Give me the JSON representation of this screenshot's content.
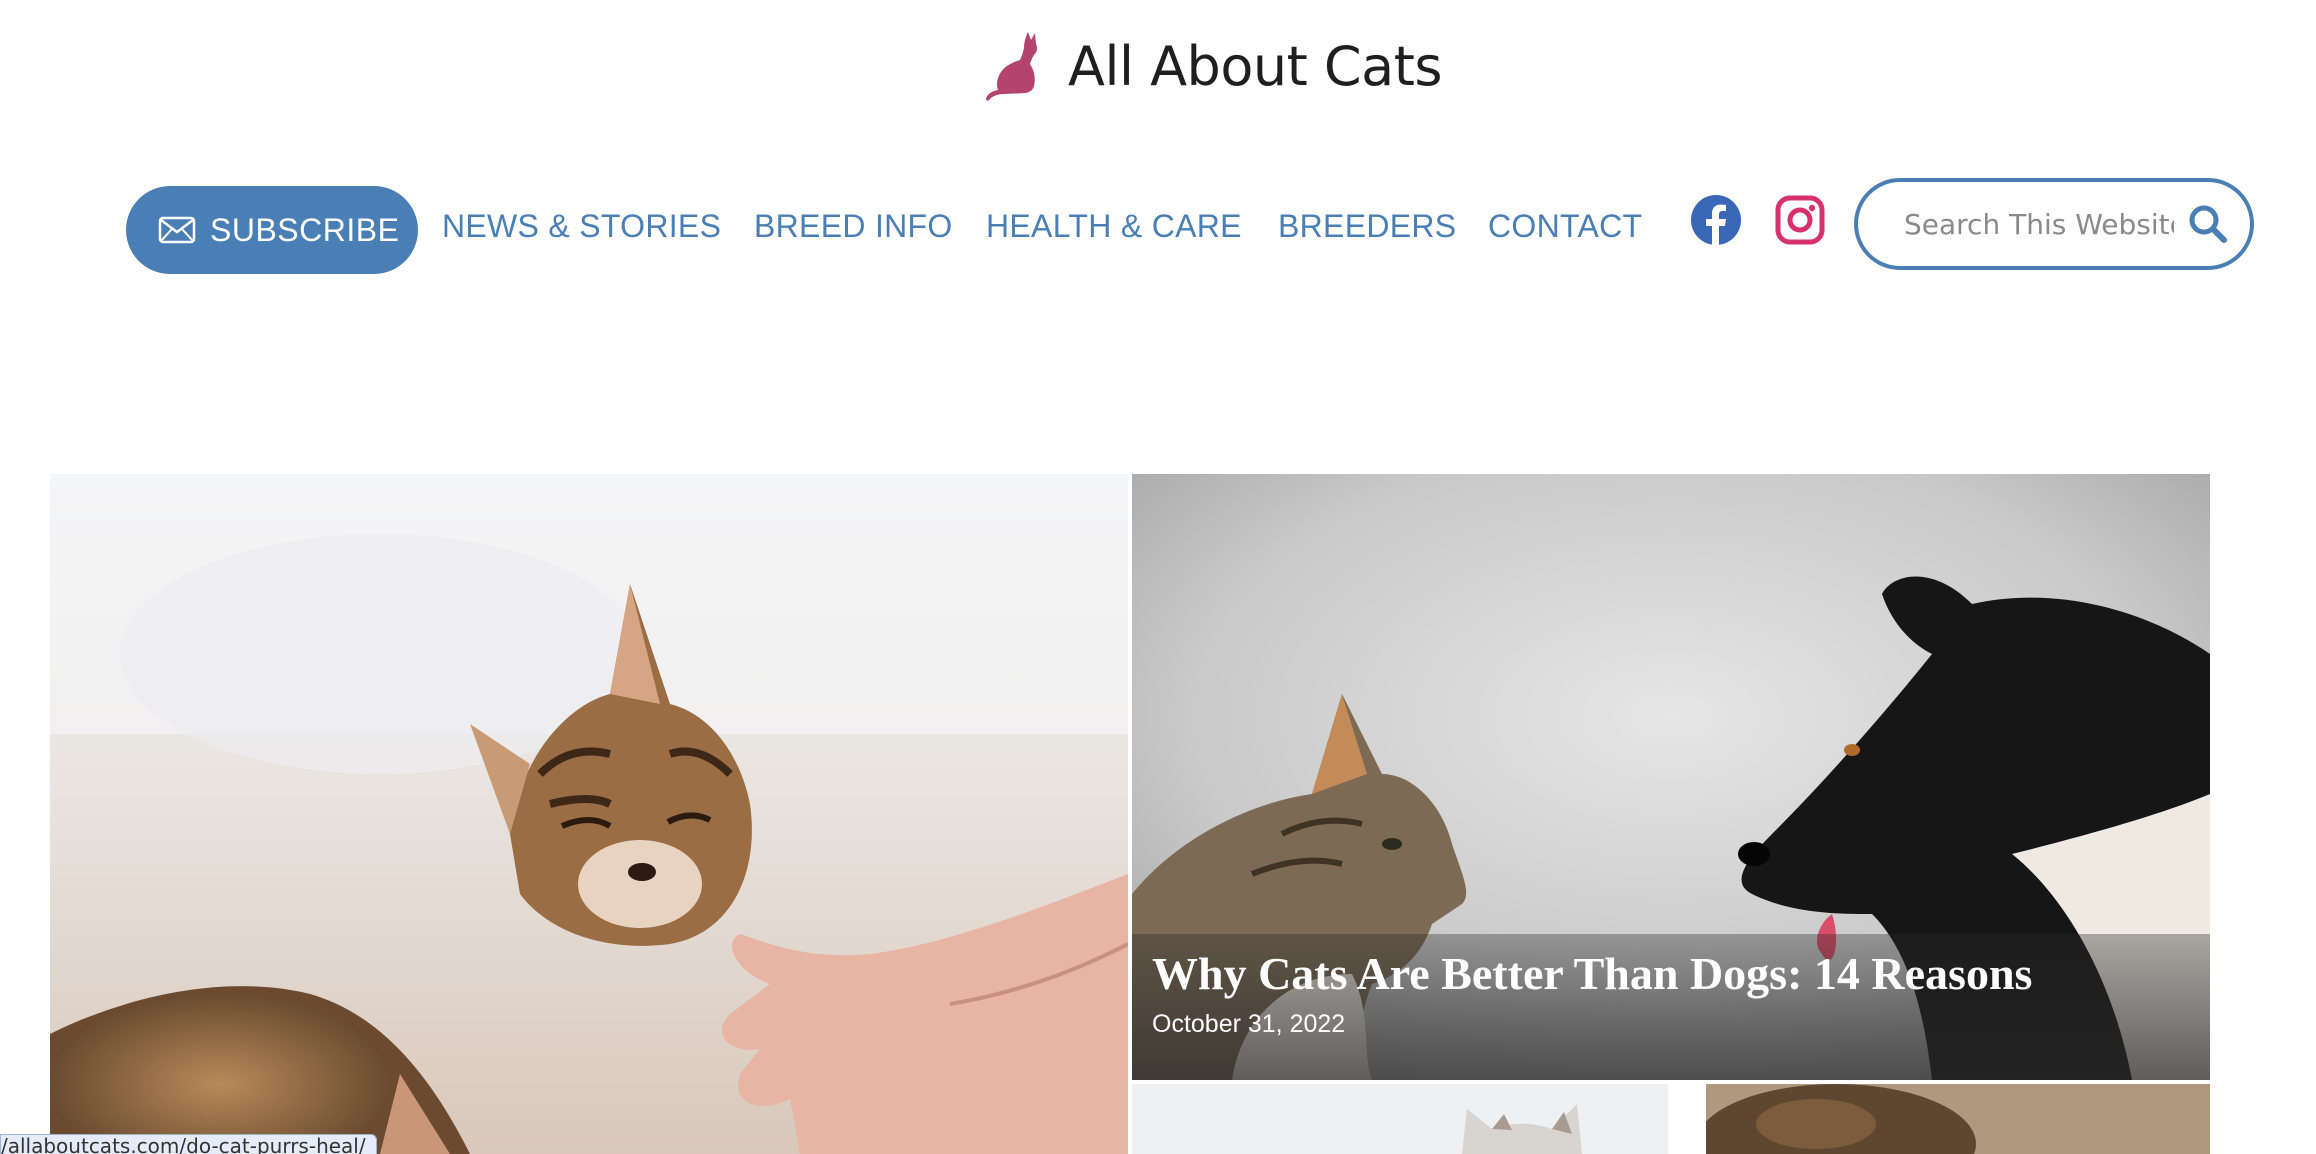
{
  "site": {
    "title": "All About Cats",
    "accent_color": "#4a7fb5",
    "logo_color": "#b4446c"
  },
  "nav": {
    "subscribe_label": "SUBSCRIBE",
    "links": [
      "NEWS & STORIES",
      "BREED INFO",
      "HEALTH & CARE",
      "BREEDERS",
      "CONTACT"
    ],
    "social": [
      "facebook-icon",
      "instagram-icon"
    ]
  },
  "search": {
    "placeholder": "Search This Website..."
  },
  "featured": {
    "right_title": "Why Cats Are Better Than Dogs: 14 Reasons",
    "right_date": "October 31, 2022"
  },
  "status_bar": {
    "url": "/allaboutcats.com/do-cat-purrs-heal/"
  }
}
